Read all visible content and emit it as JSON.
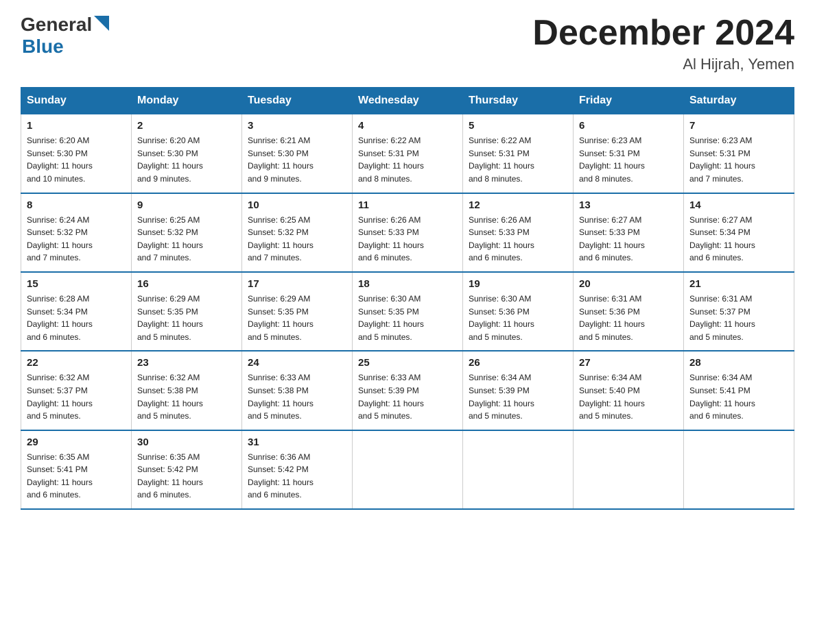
{
  "header": {
    "logo_general": "General",
    "logo_blue": "Blue",
    "month_title": "December 2024",
    "location": "Al Hijrah, Yemen"
  },
  "days_of_week": [
    "Sunday",
    "Monday",
    "Tuesday",
    "Wednesday",
    "Thursday",
    "Friday",
    "Saturday"
  ],
  "weeks": [
    [
      {
        "day": "1",
        "sunrise": "6:20 AM",
        "sunset": "5:30 PM",
        "daylight": "11 hours and 10 minutes."
      },
      {
        "day": "2",
        "sunrise": "6:20 AM",
        "sunset": "5:30 PM",
        "daylight": "11 hours and 9 minutes."
      },
      {
        "day": "3",
        "sunrise": "6:21 AM",
        "sunset": "5:30 PM",
        "daylight": "11 hours and 9 minutes."
      },
      {
        "day": "4",
        "sunrise": "6:22 AM",
        "sunset": "5:31 PM",
        "daylight": "11 hours and 8 minutes."
      },
      {
        "day": "5",
        "sunrise": "6:22 AM",
        "sunset": "5:31 PM",
        "daylight": "11 hours and 8 minutes."
      },
      {
        "day": "6",
        "sunrise": "6:23 AM",
        "sunset": "5:31 PM",
        "daylight": "11 hours and 8 minutes."
      },
      {
        "day": "7",
        "sunrise": "6:23 AM",
        "sunset": "5:31 PM",
        "daylight": "11 hours and 7 minutes."
      }
    ],
    [
      {
        "day": "8",
        "sunrise": "6:24 AM",
        "sunset": "5:32 PM",
        "daylight": "11 hours and 7 minutes."
      },
      {
        "day": "9",
        "sunrise": "6:25 AM",
        "sunset": "5:32 PM",
        "daylight": "11 hours and 7 minutes."
      },
      {
        "day": "10",
        "sunrise": "6:25 AM",
        "sunset": "5:32 PM",
        "daylight": "11 hours and 7 minutes."
      },
      {
        "day": "11",
        "sunrise": "6:26 AM",
        "sunset": "5:33 PM",
        "daylight": "11 hours and 6 minutes."
      },
      {
        "day": "12",
        "sunrise": "6:26 AM",
        "sunset": "5:33 PM",
        "daylight": "11 hours and 6 minutes."
      },
      {
        "day": "13",
        "sunrise": "6:27 AM",
        "sunset": "5:33 PM",
        "daylight": "11 hours and 6 minutes."
      },
      {
        "day": "14",
        "sunrise": "6:27 AM",
        "sunset": "5:34 PM",
        "daylight": "11 hours and 6 minutes."
      }
    ],
    [
      {
        "day": "15",
        "sunrise": "6:28 AM",
        "sunset": "5:34 PM",
        "daylight": "11 hours and 6 minutes."
      },
      {
        "day": "16",
        "sunrise": "6:29 AM",
        "sunset": "5:35 PM",
        "daylight": "11 hours and 5 minutes."
      },
      {
        "day": "17",
        "sunrise": "6:29 AM",
        "sunset": "5:35 PM",
        "daylight": "11 hours and 5 minutes."
      },
      {
        "day": "18",
        "sunrise": "6:30 AM",
        "sunset": "5:35 PM",
        "daylight": "11 hours and 5 minutes."
      },
      {
        "day": "19",
        "sunrise": "6:30 AM",
        "sunset": "5:36 PM",
        "daylight": "11 hours and 5 minutes."
      },
      {
        "day": "20",
        "sunrise": "6:31 AM",
        "sunset": "5:36 PM",
        "daylight": "11 hours and 5 minutes."
      },
      {
        "day": "21",
        "sunrise": "6:31 AM",
        "sunset": "5:37 PM",
        "daylight": "11 hours and 5 minutes."
      }
    ],
    [
      {
        "day": "22",
        "sunrise": "6:32 AM",
        "sunset": "5:37 PM",
        "daylight": "11 hours and 5 minutes."
      },
      {
        "day": "23",
        "sunrise": "6:32 AM",
        "sunset": "5:38 PM",
        "daylight": "11 hours and 5 minutes."
      },
      {
        "day": "24",
        "sunrise": "6:33 AM",
        "sunset": "5:38 PM",
        "daylight": "11 hours and 5 minutes."
      },
      {
        "day": "25",
        "sunrise": "6:33 AM",
        "sunset": "5:39 PM",
        "daylight": "11 hours and 5 minutes."
      },
      {
        "day": "26",
        "sunrise": "6:34 AM",
        "sunset": "5:39 PM",
        "daylight": "11 hours and 5 minutes."
      },
      {
        "day": "27",
        "sunrise": "6:34 AM",
        "sunset": "5:40 PM",
        "daylight": "11 hours and 5 minutes."
      },
      {
        "day": "28",
        "sunrise": "6:34 AM",
        "sunset": "5:41 PM",
        "daylight": "11 hours and 6 minutes."
      }
    ],
    [
      {
        "day": "29",
        "sunrise": "6:35 AM",
        "sunset": "5:41 PM",
        "daylight": "11 hours and 6 minutes."
      },
      {
        "day": "30",
        "sunrise": "6:35 AM",
        "sunset": "5:42 PM",
        "daylight": "11 hours and 6 minutes."
      },
      {
        "day": "31",
        "sunrise": "6:36 AM",
        "sunset": "5:42 PM",
        "daylight": "11 hours and 6 minutes."
      },
      null,
      null,
      null,
      null
    ]
  ],
  "labels": {
    "sunrise": "Sunrise:",
    "sunset": "Sunset:",
    "daylight": "Daylight:"
  }
}
